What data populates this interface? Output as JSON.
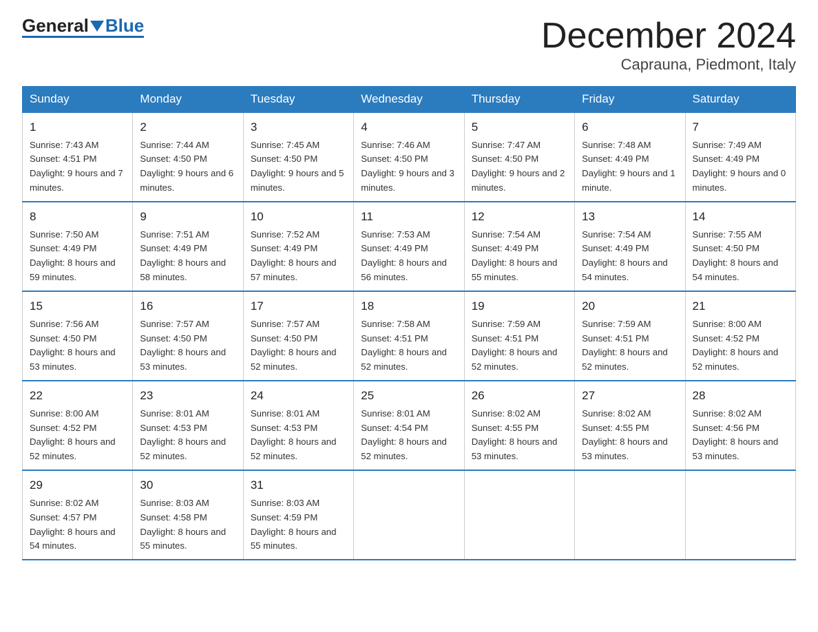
{
  "header": {
    "logo_general": "General",
    "logo_blue": "Blue",
    "title": "December 2024",
    "subtitle": "Caprauna, Piedmont, Italy"
  },
  "days_of_week": [
    "Sunday",
    "Monday",
    "Tuesday",
    "Wednesday",
    "Thursday",
    "Friday",
    "Saturday"
  ],
  "weeks": [
    [
      {
        "day": "1",
        "sunrise": "7:43 AM",
        "sunset": "4:51 PM",
        "daylight": "9 hours and 7 minutes."
      },
      {
        "day": "2",
        "sunrise": "7:44 AM",
        "sunset": "4:50 PM",
        "daylight": "9 hours and 6 minutes."
      },
      {
        "day": "3",
        "sunrise": "7:45 AM",
        "sunset": "4:50 PM",
        "daylight": "9 hours and 5 minutes."
      },
      {
        "day": "4",
        "sunrise": "7:46 AM",
        "sunset": "4:50 PM",
        "daylight": "9 hours and 3 minutes."
      },
      {
        "day": "5",
        "sunrise": "7:47 AM",
        "sunset": "4:50 PM",
        "daylight": "9 hours and 2 minutes."
      },
      {
        "day": "6",
        "sunrise": "7:48 AM",
        "sunset": "4:49 PM",
        "daylight": "9 hours and 1 minute."
      },
      {
        "day": "7",
        "sunrise": "7:49 AM",
        "sunset": "4:49 PM",
        "daylight": "9 hours and 0 minutes."
      }
    ],
    [
      {
        "day": "8",
        "sunrise": "7:50 AM",
        "sunset": "4:49 PM",
        "daylight": "8 hours and 59 minutes."
      },
      {
        "day": "9",
        "sunrise": "7:51 AM",
        "sunset": "4:49 PM",
        "daylight": "8 hours and 58 minutes."
      },
      {
        "day": "10",
        "sunrise": "7:52 AM",
        "sunset": "4:49 PM",
        "daylight": "8 hours and 57 minutes."
      },
      {
        "day": "11",
        "sunrise": "7:53 AM",
        "sunset": "4:49 PM",
        "daylight": "8 hours and 56 minutes."
      },
      {
        "day": "12",
        "sunrise": "7:54 AM",
        "sunset": "4:49 PM",
        "daylight": "8 hours and 55 minutes."
      },
      {
        "day": "13",
        "sunrise": "7:54 AM",
        "sunset": "4:49 PM",
        "daylight": "8 hours and 54 minutes."
      },
      {
        "day": "14",
        "sunrise": "7:55 AM",
        "sunset": "4:50 PM",
        "daylight": "8 hours and 54 minutes."
      }
    ],
    [
      {
        "day": "15",
        "sunrise": "7:56 AM",
        "sunset": "4:50 PM",
        "daylight": "8 hours and 53 minutes."
      },
      {
        "day": "16",
        "sunrise": "7:57 AM",
        "sunset": "4:50 PM",
        "daylight": "8 hours and 53 minutes."
      },
      {
        "day": "17",
        "sunrise": "7:57 AM",
        "sunset": "4:50 PM",
        "daylight": "8 hours and 52 minutes."
      },
      {
        "day": "18",
        "sunrise": "7:58 AM",
        "sunset": "4:51 PM",
        "daylight": "8 hours and 52 minutes."
      },
      {
        "day": "19",
        "sunrise": "7:59 AM",
        "sunset": "4:51 PM",
        "daylight": "8 hours and 52 minutes."
      },
      {
        "day": "20",
        "sunrise": "7:59 AM",
        "sunset": "4:51 PM",
        "daylight": "8 hours and 52 minutes."
      },
      {
        "day": "21",
        "sunrise": "8:00 AM",
        "sunset": "4:52 PM",
        "daylight": "8 hours and 52 minutes."
      }
    ],
    [
      {
        "day": "22",
        "sunrise": "8:00 AM",
        "sunset": "4:52 PM",
        "daylight": "8 hours and 52 minutes."
      },
      {
        "day": "23",
        "sunrise": "8:01 AM",
        "sunset": "4:53 PM",
        "daylight": "8 hours and 52 minutes."
      },
      {
        "day": "24",
        "sunrise": "8:01 AM",
        "sunset": "4:53 PM",
        "daylight": "8 hours and 52 minutes."
      },
      {
        "day": "25",
        "sunrise": "8:01 AM",
        "sunset": "4:54 PM",
        "daylight": "8 hours and 52 minutes."
      },
      {
        "day": "26",
        "sunrise": "8:02 AM",
        "sunset": "4:55 PM",
        "daylight": "8 hours and 53 minutes."
      },
      {
        "day": "27",
        "sunrise": "8:02 AM",
        "sunset": "4:55 PM",
        "daylight": "8 hours and 53 minutes."
      },
      {
        "day": "28",
        "sunrise": "8:02 AM",
        "sunset": "4:56 PM",
        "daylight": "8 hours and 53 minutes."
      }
    ],
    [
      {
        "day": "29",
        "sunrise": "8:02 AM",
        "sunset": "4:57 PM",
        "daylight": "8 hours and 54 minutes."
      },
      {
        "day": "30",
        "sunrise": "8:03 AM",
        "sunset": "4:58 PM",
        "daylight": "8 hours and 55 minutes."
      },
      {
        "day": "31",
        "sunrise": "8:03 AM",
        "sunset": "4:59 PM",
        "daylight": "8 hours and 55 minutes."
      },
      null,
      null,
      null,
      null
    ]
  ],
  "labels": {
    "sunrise": "Sunrise:",
    "sunset": "Sunset:",
    "daylight": "Daylight:"
  }
}
